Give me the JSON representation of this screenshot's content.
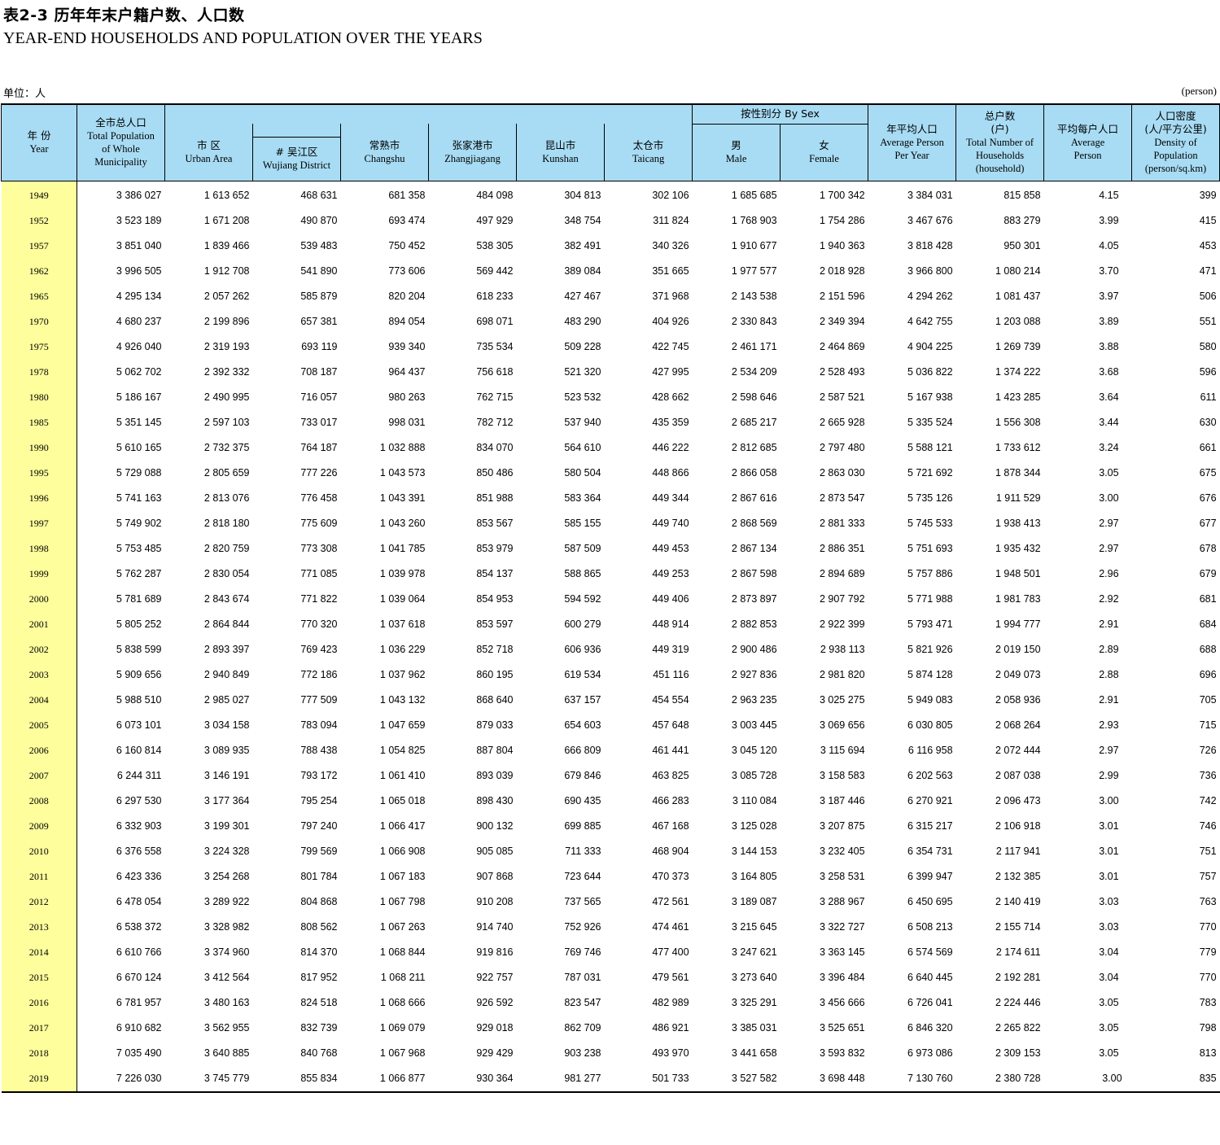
{
  "title_cn": "表2-3  历年年末户籍户数、人口数",
  "title_en": "YEAR-END HOUSEHOLDS AND POPULATION OVER THE YEARS",
  "unit_cn": "单位：人",
  "unit_en": "(person)",
  "headers": {
    "year": [
      "年 份",
      "Year"
    ],
    "total": [
      "全市总人口",
      "Total Population",
      "of Whole",
      "Municipality"
    ],
    "urban": [
      "市 区",
      "Urban Area"
    ],
    "wujiang": [
      "# 吴江区",
      "Wujiang District"
    ],
    "changshu": [
      "常熟市",
      "Changshu"
    ],
    "zhangjiagang": [
      "张家港市",
      "Zhangjiagang"
    ],
    "kunshan": [
      "昆山市",
      "Kunshan"
    ],
    "taicang": [
      "太仓市",
      "Taicang"
    ],
    "by_sex": "按性别分  By Sex",
    "male": [
      "男",
      "Male"
    ],
    "female": [
      "女",
      "Female"
    ],
    "avg_pop": [
      "年平均人口",
      "Average Person",
      "Per Year"
    ],
    "households": [
      "总户数",
      "(户)",
      "Total Number of",
      "Households",
      "(household)"
    ],
    "avg_per_hh": [
      "平均每户人口",
      "Average",
      "Person"
    ],
    "density": [
      "人口密度",
      "(人/平方公里)",
      "Density of",
      "Population",
      "(person/sq.km)"
    ]
  },
  "rows": [
    [
      "1949",
      "3 386 027",
      "1 613 652",
      "468 631",
      "681 358",
      "484 098",
      "304 813",
      "302 106",
      "1 685 685",
      "1 700 342",
      "3 384 031",
      "815 858",
      "4.15",
      "399"
    ],
    [
      "1952",
      "3 523 189",
      "1 671 208",
      "490 870",
      "693 474",
      "497 929",
      "348 754",
      "311 824",
      "1 768 903",
      "1 754 286",
      "3 467 676",
      "883 279",
      "3.99",
      "415"
    ],
    [
      "1957",
      "3 851 040",
      "1 839 466",
      "539 483",
      "750 452",
      "538 305",
      "382 491",
      "340 326",
      "1 910 677",
      "1 940 363",
      "3 818 428",
      "950 301",
      "4.05",
      "453"
    ],
    [
      "1962",
      "3 996 505",
      "1 912 708",
      "541 890",
      "773 606",
      "569 442",
      "389 084",
      "351 665",
      "1 977 577",
      "2 018 928",
      "3 966 800",
      "1 080 214",
      "3.70",
      "471"
    ],
    [
      "1965",
      "4 295 134",
      "2 057 262",
      "585 879",
      "820 204",
      "618 233",
      "427 467",
      "371 968",
      "2 143 538",
      "2 151 596",
      "4 294 262",
      "1 081 437",
      "3.97",
      "506"
    ],
    [
      "1970",
      "4 680 237",
      "2 199 896",
      "657 381",
      "894 054",
      "698 071",
      "483 290",
      "404 926",
      "2 330 843",
      "2 349 394",
      "4 642 755",
      "1 203 088",
      "3.89",
      "551"
    ],
    [
      "1975",
      "4 926 040",
      "2 319 193",
      "693 119",
      "939 340",
      "735 534",
      "509 228",
      "422 745",
      "2 461 171",
      "2 464 869",
      "4 904 225",
      "1 269 739",
      "3.88",
      "580"
    ],
    [
      "1978",
      "5 062 702",
      "2 392 332",
      "708 187",
      "964 437",
      "756 618",
      "521 320",
      "427 995",
      "2 534 209",
      "2 528 493",
      "5 036 822",
      "1 374 222",
      "3.68",
      "596"
    ],
    [
      "1980",
      "5 186 167",
      "2 490 995",
      "716 057",
      "980 263",
      "762 715",
      "523 532",
      "428 662",
      "2 598 646",
      "2 587 521",
      "5 167 938",
      "1 423 285",
      "3.64",
      "611"
    ],
    [
      "1985",
      "5 351 145",
      "2 597 103",
      "733 017",
      "998 031",
      "782 712",
      "537 940",
      "435 359",
      "2 685 217",
      "2 665 928",
      "5 335 524",
      "1 556 308",
      "3.44",
      "630"
    ],
    [
      "1990",
      "5 610 165",
      "2 732 375",
      "764 187",
      "1 032 888",
      "834 070",
      "564 610",
      "446 222",
      "2 812 685",
      "2 797 480",
      "5 588 121",
      "1 733 612",
      "3.24",
      "661"
    ],
    [
      "1995",
      "5 729 088",
      "2 805 659",
      "777 226",
      "1 043 573",
      "850 486",
      "580 504",
      "448 866",
      "2 866 058",
      "2 863 030",
      "5 721 692",
      "1 878 344",
      "3.05",
      "675"
    ],
    [
      "1996",
      "5 741 163",
      "2 813 076",
      "776 458",
      "1 043 391",
      "851 988",
      "583 364",
      "449 344",
      "2 867 616",
      "2 873 547",
      "5 735 126",
      "1 911 529",
      "3.00",
      "676"
    ],
    [
      "1997",
      "5 749 902",
      "2 818 180",
      "775 609",
      "1 043 260",
      "853 567",
      "585 155",
      "449 740",
      "2 868 569",
      "2 881 333",
      "5 745 533",
      "1 938 413",
      "2.97",
      "677"
    ],
    [
      "1998",
      "5 753 485",
      "2 820 759",
      "773 308",
      "1 041 785",
      "853 979",
      "587 509",
      "449 453",
      "2 867 134",
      "2 886 351",
      "5 751 693",
      "1 935 432",
      "2.97",
      "678"
    ],
    [
      "1999",
      "5 762 287",
      "2 830 054",
      "771 085",
      "1 039 978",
      "854 137",
      "588 865",
      "449 253",
      "2 867 598",
      "2 894 689",
      "5 757 886",
      "1 948 501",
      "2.96",
      "679"
    ],
    [
      "2000",
      "5 781 689",
      "2 843 674",
      "771 822",
      "1 039 064",
      "854 953",
      "594 592",
      "449 406",
      "2 873 897",
      "2 907 792",
      "5 771 988",
      "1 981 783",
      "2.92",
      "681"
    ],
    [
      "2001",
      "5 805 252",
      "2 864 844",
      "770 320",
      "1 037 618",
      "853 597",
      "600 279",
      "448 914",
      "2 882 853",
      "2 922 399",
      "5 793 471",
      "1 994 777",
      "2.91",
      "684"
    ],
    [
      "2002",
      "5 838 599",
      "2 893 397",
      "769 423",
      "1 036 229",
      "852 718",
      "606 936",
      "449 319",
      "2 900 486",
      "2 938 113",
      "5 821 926",
      "2 019 150",
      "2.89",
      "688"
    ],
    [
      "2003",
      "5 909 656",
      "2 940 849",
      "772 186",
      "1 037 962",
      "860 195",
      "619 534",
      "451 116",
      "2 927 836",
      "2 981 820",
      "5 874 128",
      "2 049 073",
      "2.88",
      "696"
    ],
    [
      "2004",
      "5 988 510",
      "2 985 027",
      "777 509",
      "1 043 132",
      "868 640",
      "637 157",
      "454 554",
      "2 963 235",
      "3 025 275",
      "5 949 083",
      "2 058 936",
      "2.91",
      "705"
    ],
    [
      "2005",
      "6 073 101",
      "3 034 158",
      "783 094",
      "1 047 659",
      "879 033",
      "654 603",
      "457 648",
      "3 003 445",
      "3 069 656",
      "6 030 805",
      "2 068 264",
      "2.93",
      "715"
    ],
    [
      "2006",
      "6 160 814",
      "3 089 935",
      "788 438",
      "1 054 825",
      "887 804",
      "666 809",
      "461 441",
      "3 045 120",
      "3 115 694",
      "6 116 958",
      "2 072 444",
      "2.97",
      "726"
    ],
    [
      "2007",
      "6 244 311",
      "3 146 191",
      "793 172",
      "1 061 410",
      "893 039",
      "679 846",
      "463 825",
      "3 085 728",
      "3 158 583",
      "6 202 563",
      "2 087 038",
      "2.99",
      "736"
    ],
    [
      "2008",
      "6 297 530",
      "3 177 364",
      "795 254",
      "1 065 018",
      "898 430",
      "690 435",
      "466 283",
      "3 110 084",
      "3 187 446",
      "6 270 921",
      "2 096 473",
      "3.00",
      "742"
    ],
    [
      "2009",
      "6 332 903",
      "3 199 301",
      "797 240",
      "1 066 417",
      "900 132",
      "699 885",
      "467 168",
      "3 125 028",
      "3 207 875",
      "6 315 217",
      "2 106 918",
      "3.01",
      "746"
    ],
    [
      "2010",
      "6 376 558",
      "3 224 328",
      "799 569",
      "1 066 908",
      "905 085",
      "711 333",
      "468 904",
      "3 144 153",
      "3 232 405",
      "6 354 731",
      "2 117 941",
      "3.01",
      "751"
    ],
    [
      "2011",
      "6 423 336",
      "3 254 268",
      "801 784",
      "1 067 183",
      "907 868",
      "723 644",
      "470 373",
      "3 164 805",
      "3 258 531",
      "6 399 947",
      "2 132 385",
      "3.01",
      "757"
    ],
    [
      "2012",
      "6 478 054",
      "3 289 922",
      "804 868",
      "1 067 798",
      "910 208",
      "737 565",
      "472 561",
      "3 189 087",
      "3 288 967",
      "6 450 695",
      "2 140 419",
      "3.03",
      "763"
    ],
    [
      "2013",
      "6 538 372",
      "3 328 982",
      "808 562",
      "1 067 263",
      "914 740",
      "752 926",
      "474 461",
      "3 215 645",
      "3 322 727",
      "6 508 213",
      "2 155 714",
      "3.03",
      "770"
    ],
    [
      "2014",
      "6 610 766",
      "3 374 960",
      "814 370",
      "1 068 844",
      "919 816",
      "769 746",
      "477 400",
      "3 247 621",
      "3 363 145",
      "6 574 569",
      "2 174 611",
      "3.04",
      "779"
    ],
    [
      "2015",
      "6 670 124",
      "3 412 564",
      "817 952",
      "1 068 211",
      "922 757",
      "787 031",
      "479 561",
      "3 273 640",
      "3 396 484",
      "6 640 445",
      "2 192 281",
      "3.04",
      "770"
    ],
    [
      "2016",
      "6 781 957",
      "3 480 163",
      "824 518",
      "1 068 666",
      "926 592",
      "823 547",
      "482 989",
      "3 325 291",
      "3 456 666",
      "6 726 041",
      "2 224 446",
      "3.05",
      "783"
    ],
    [
      "2017",
      "6 910 682",
      "3 562 955",
      "832 739",
      "1 069 079",
      "929 018",
      "862 709",
      "486 921",
      "3 385 031",
      "3 525 651",
      "6 846 320",
      "2 265 822",
      "3.05",
      "798"
    ],
    [
      "2018",
      "7 035 490",
      "3 640 885",
      "840 768",
      "1 067 968",
      "929 429",
      "903 238",
      "493 970",
      "3 441 658",
      "3 593 832",
      "6 973 086",
      "2 309 153",
      "3.05",
      "813"
    ],
    [
      "2019",
      "7 226 030",
      "3 745 779",
      "855 834",
      "1 066 877",
      "930 364",
      "981 277",
      "501 733",
      "3 527 582",
      "3 698 448",
      "7 130 760",
      "2 380 728",
      "3.00",
      "835"
    ]
  ]
}
